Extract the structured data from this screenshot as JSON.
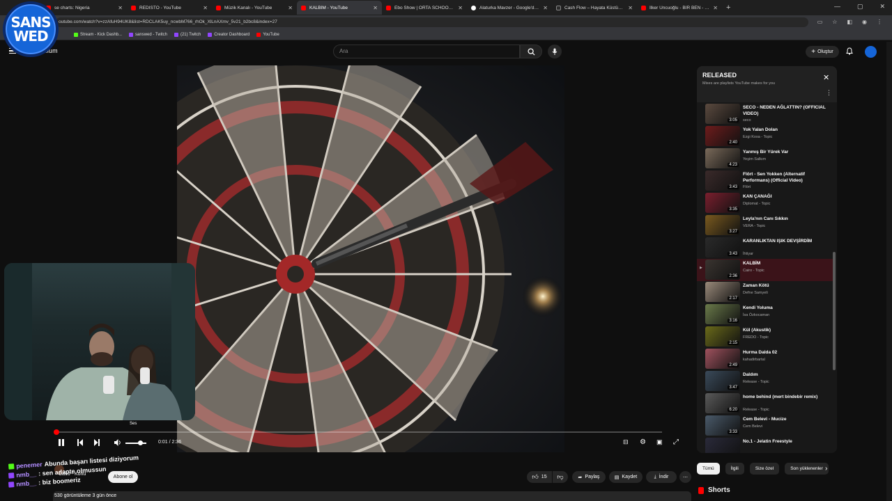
{
  "browser": {
    "tabs": [
      {
        "title": "se charts: Nigeria",
        "icon": "youtube-icon",
        "active": false
      },
      {
        "title": "REDISTO - YouTube",
        "icon": "youtube-icon",
        "active": false
      },
      {
        "title": "Müzik Kanalı - YouTube",
        "icon": "youtube-icon",
        "active": false
      },
      {
        "title": "KALBİM - YouTube",
        "icon": "youtube-icon",
        "active": true
      },
      {
        "title": "Ebo Show | ORTA SCHOOL - Yo",
        "icon": "youtube-icon",
        "active": false
      },
      {
        "title": "Alaturka Mavzer - Google'da A",
        "icon": "google-icon",
        "active": false
      },
      {
        "title": "Cash Flow – Hayata Küstüm Ly",
        "icon": "genius-icon",
        "active": false
      },
      {
        "title": "İlker Uncuoğlu - BİR BEN - You",
        "icon": "youtube-icon",
        "active": false
      }
    ],
    "url": "outube.com/watch?v=zzAfuH94UK8&list=RDCLAK5uy_ncwbM766_rhOk_XlLnAXmv_5v21_b2bc8&index=27",
    "bookmarks": [
      {
        "label": "Stream - Kick Dashb...",
        "icon": "kick-icon"
      },
      {
        "label": "sanswed - Twitch",
        "icon": "twitch-icon"
      },
      {
        "label": "(21) Twitch",
        "icon": "twitch-icon"
      },
      {
        "label": "Creator Dashboard",
        "icon": "twitch-icon"
      },
      {
        "label": "YouTube",
        "icon": "youtube-icon"
      }
    ]
  },
  "overlay": {
    "logo_line1": "SANS",
    "logo_line2": "WED"
  },
  "youtube": {
    "brand": "mium",
    "search_placeholder": "Ara",
    "create_label": "Oluştur",
    "player": {
      "time": "0:01 / 2:36",
      "volume_tooltip": "Ses",
      "progress_fraction": 0.004,
      "volume_fraction": 0.7
    },
    "channel": {
      "name": "Cairo - Konu",
      "subscribe_label": "Abone ol"
    },
    "actions": {
      "likes": "15",
      "share": "Paylaş",
      "save": "Kaydet",
      "download": "İndir"
    },
    "views_line": "530 görüntüleme  3 gün önce",
    "chat": [
      {
        "user": "penemer",
        "text": "Abunda başarı listesi diziyorum ",
        "badge": "kick"
      },
      {
        "user": "nmb__",
        "text": ": sen adapte olmussun",
        "badge": "twitch"
      },
      {
        "user": "nmb__",
        "text": ": biz boomeriz",
        "badge": "twitch"
      }
    ],
    "panel": {
      "title": "RELEASED",
      "subtitle": "Mixes are playlists YouTube makes for you",
      "items": [
        {
          "title": "SECO - NEDEN AĞLATTIN? (OFFICIAL VIDEO)",
          "artist": "seco",
          "duration": "3:05",
          "thumb": "#5b4a3f"
        },
        {
          "title": "Yok Yalan Dolan",
          "artist": "Ezgi Kosa - Topic",
          "duration": "2:40",
          "thumb": "#6e1c1c"
        },
        {
          "title": "Yanmış Bir Yürek Var",
          "artist": "Yeşim Salkım",
          "duration": "4:23",
          "thumb": "#7a6a5a"
        },
        {
          "title": "Flört - Sen Yokken (Alternatif Performans) (Official Video)",
          "artist": "Flört",
          "duration": "3:43",
          "thumb": "#3a2a2a"
        },
        {
          "title": "KAN ÇANAĞI",
          "artist": "Diplomat - Topic",
          "duration": "3:35",
          "thumb": "#7a1f2e"
        },
        {
          "title": "Leyla'nın Canı Sıkkın",
          "artist": "VERA - Topic",
          "duration": "3:27",
          "thumb": "#7a5a1f"
        },
        {
          "title": "KARANLIKTAN IŞIK DEVŞİRDİM",
          "artist": "İhtiyar",
          "duration": "3:43",
          "thumb": "#2a2a2a"
        },
        {
          "title": "KALBİM",
          "artist": "Cairo - Topic",
          "duration": "2:36",
          "thumb": "#3a3430",
          "active": true
        },
        {
          "title": "Zaman Kötü",
          "artist": "Defne Samyeli",
          "duration": "2:17",
          "thumb": "#9a8a7a"
        },
        {
          "title": "Kendi Yoluma",
          "artist": "İsa Özkocaman",
          "duration": "3:16",
          "thumb": "#6a7a4a"
        },
        {
          "title": "Kül (Akustik)",
          "artist": "FREDO - Topic",
          "duration": "2:15",
          "thumb": "#6a6a1a"
        },
        {
          "title": "Hurma Dalda 02",
          "artist": "kahadirbartal",
          "duration": "2:49",
          "thumb": "#a0525e"
        },
        {
          "title": "Daldım",
          "artist": "Release - Topic",
          "duration": "3:47",
          "thumb": "#3a4a5a"
        },
        {
          "title": "home behind (mert bindebir remix)",
          "artist": "Release - Topic",
          "duration": "6:20",
          "thumb": "#5a5a5a"
        },
        {
          "title": "Cem Belevi - Mucize",
          "artist": "Cem Belevi",
          "duration": "3:33",
          "thumb": "#4a5a6a"
        },
        {
          "title": "No.1 - Jelatin Freestyle",
          "artist": "",
          "duration": "",
          "thumb": "#2a2a3a"
        }
      ]
    },
    "chips": [
      "Tümü",
      "İlgili",
      "Size özel",
      "Son yüklenenler"
    ],
    "shorts_label": "Shorts"
  }
}
